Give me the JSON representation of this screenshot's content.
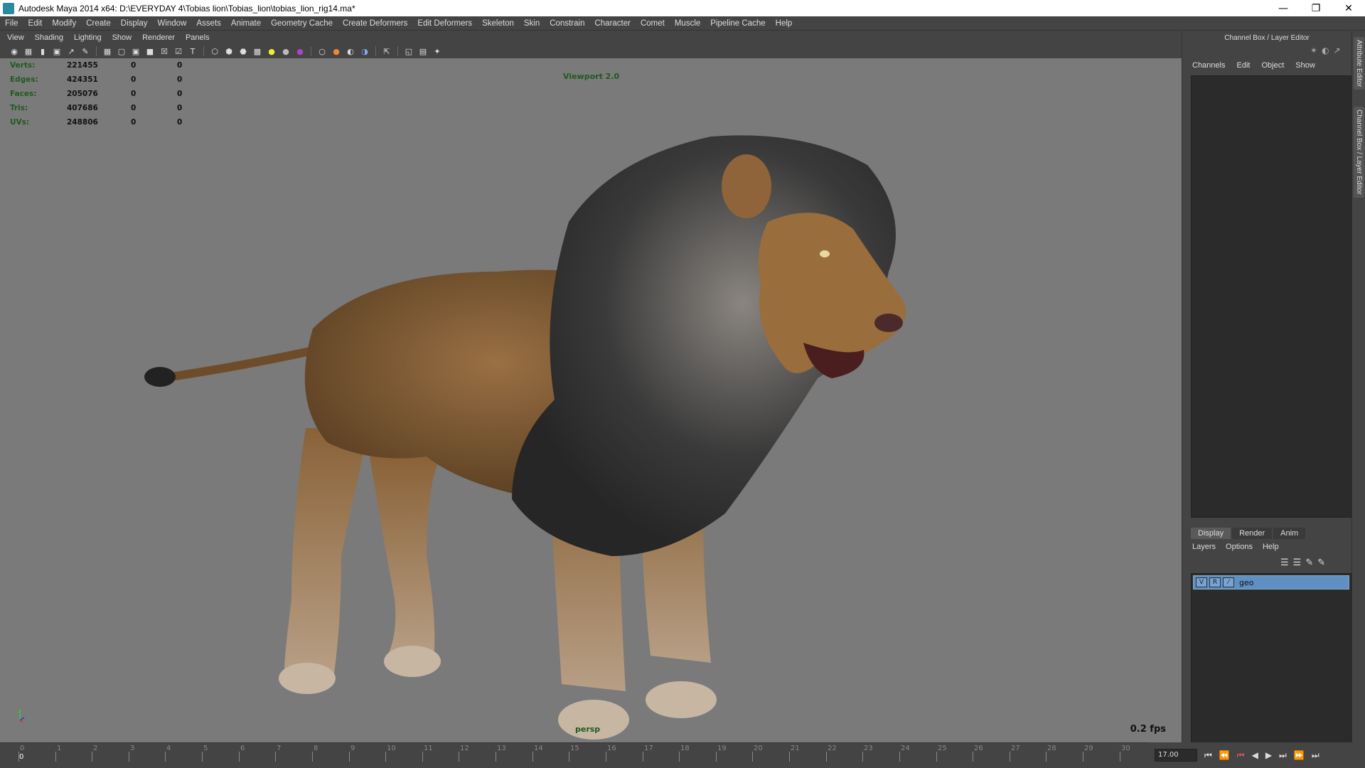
{
  "window": {
    "title": "Autodesk Maya 2014 x64: D:\\EVERYDAY 4\\Tobias lion\\Tobias_lion\\tobias_lion_rig14.ma*"
  },
  "menubar": [
    "File",
    "Edit",
    "Modify",
    "Create",
    "Display",
    "Window",
    "Assets",
    "Animate",
    "Geometry Cache",
    "Create Deformers",
    "Edit Deformers",
    "Skeleton",
    "Skin",
    "Constrain",
    "Character",
    "Comet",
    "Muscle",
    "Pipeline Cache",
    "Help"
  ],
  "panel_menu": [
    "View",
    "Shading",
    "Lighting",
    "Show",
    "Renderer",
    "Panels"
  ],
  "hud": {
    "rows": [
      {
        "label": "Verts:",
        "value": "221455",
        "a": "0",
        "b": "0"
      },
      {
        "label": "Edges:",
        "value": "424351",
        "a": "0",
        "b": "0"
      },
      {
        "label": "Faces:",
        "value": "205076",
        "a": "0",
        "b": "0"
      },
      {
        "label": "Tris:",
        "value": "407686",
        "a": "0",
        "b": "0"
      },
      {
        "label": "UVs:",
        "value": "248806",
        "a": "0",
        "b": "0"
      }
    ]
  },
  "viewport": {
    "renderer_label": "Viewport 2.0",
    "camera": "persp",
    "fps": "0.2 fps"
  },
  "channel_box": {
    "header": "Channel Box / Layer Editor",
    "menu": [
      "Channels",
      "Edit",
      "Object",
      "Show"
    ],
    "side_tabs": [
      "Attribute Editor",
      "Channel Box / Layer Editor"
    ]
  },
  "layer_editor": {
    "tabs": [
      "Display",
      "Render",
      "Anim"
    ],
    "menu": [
      "Layers",
      "Options",
      "Help"
    ],
    "layers": [
      {
        "v": "V",
        "r": "R",
        "name": "geo"
      }
    ]
  },
  "timeline": {
    "ticks": [
      "0",
      "1",
      "2",
      "3",
      "4",
      "5",
      "6",
      "7",
      "8",
      "9",
      "10",
      "11",
      "12",
      "13",
      "14",
      "15",
      "16",
      "17",
      "18",
      "19",
      "20",
      "21",
      "22",
      "23",
      "24",
      "25",
      "26",
      "27",
      "28",
      "29",
      "30"
    ],
    "current_frame": "0",
    "frame_field": "17.00"
  },
  "colors": {
    "viewport_bg": "#7a7a7a",
    "hud_label": "#1f5a1f",
    "layer_selected": "#5f8fc4"
  }
}
